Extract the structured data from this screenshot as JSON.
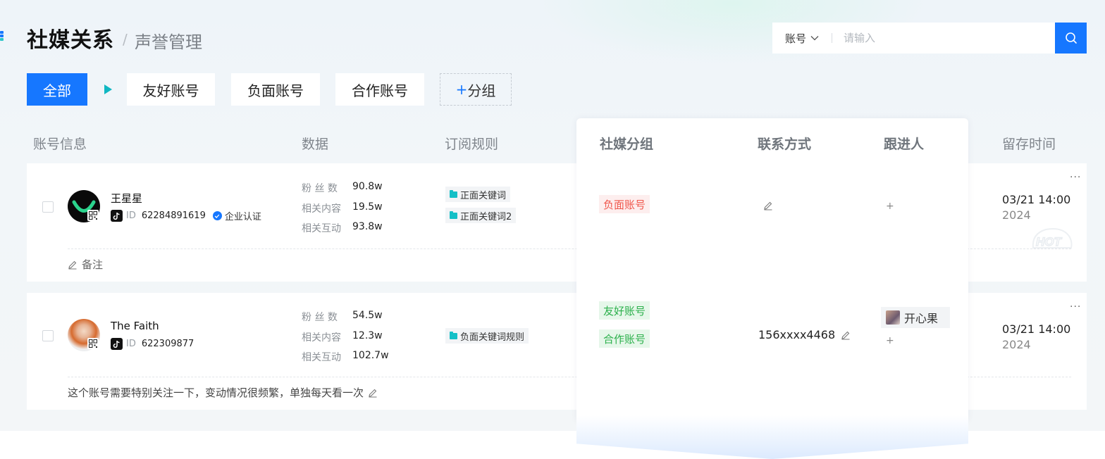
{
  "header": {
    "title": "社媒关系",
    "separator": "/",
    "subtitle": "声誉管理"
  },
  "search": {
    "type_label": "账号",
    "placeholder": "请输入",
    "value": ""
  },
  "tabs": [
    {
      "label": "全部",
      "active": true
    },
    {
      "label": "友好账号",
      "active": false
    },
    {
      "label": "负面账号",
      "active": false
    },
    {
      "label": "合作账号",
      "active": false
    }
  ],
  "add_group": {
    "plus": "+",
    "label": "分组"
  },
  "columns": {
    "account": "账号信息",
    "data": "数据",
    "rules": "订阅规则",
    "group": "社媒分组",
    "contact": "联系方式",
    "follower": "跟进人",
    "time": "留存时间"
  },
  "stat_labels": {
    "fans": "粉 丝 数",
    "content": "相关内容",
    "interaction": "相关互动"
  },
  "rows": [
    {
      "name": "王星星",
      "id_label": "ID",
      "id": "62284891619",
      "verified_label": "企业认证",
      "fans": "90.8w",
      "content": "19.5w",
      "interaction": "93.8w",
      "keywords": [
        "正面关键词",
        "正面关键词2"
      ],
      "groups": [
        "负面账号"
      ],
      "contact": "",
      "follower_add": "+",
      "time": "03/21 14:00",
      "year": "2024",
      "note": "备注",
      "more": "···"
    },
    {
      "name": "The Faith",
      "id_label": "ID",
      "id": "622309877",
      "fans": "54.5w",
      "content": "12.3w",
      "interaction": "102.7w",
      "keywords": [
        "负面关键词规则"
      ],
      "groups": [
        "友好账号",
        "合作账号"
      ],
      "contact": "156xxxx4468",
      "follower": "开心果",
      "follower_add": "+",
      "time": "03/21 14:00",
      "year": "2024",
      "note": "这个账号需要特别关注一下，变动情况很频繁，单独每天看一次",
      "more": "···"
    }
  ],
  "colors": {
    "primary": "#1677ff",
    "accent": "#14c0c7",
    "negative": "#f0564b",
    "positive": "#2bb04b"
  }
}
